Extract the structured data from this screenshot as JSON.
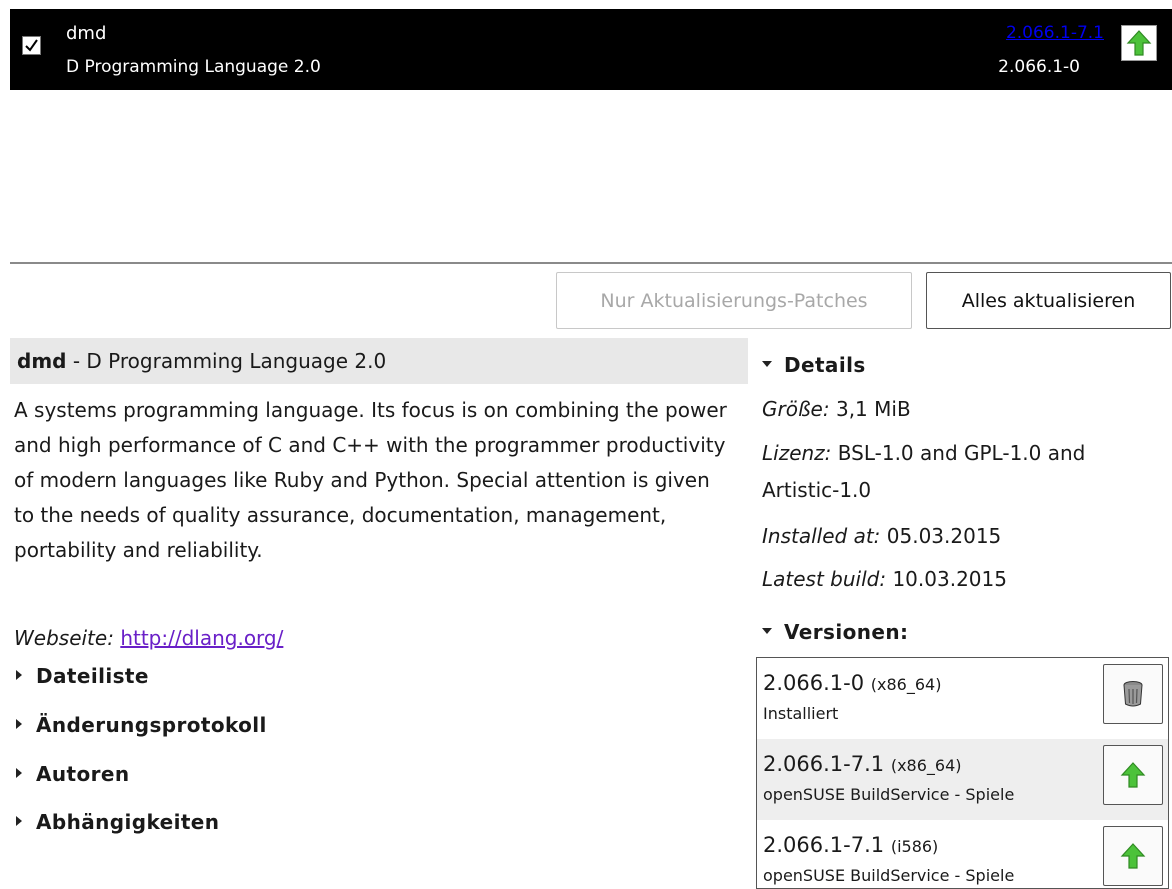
{
  "package": {
    "name": "dmd",
    "summary": "D Programming Language 2.0",
    "available_version": "2.066.1-7.1",
    "installed_version": "2.066.1-0",
    "checked": true
  },
  "buttons": {
    "patches_only": "Nur Aktualisierungs-Patches",
    "update_all": "Alles aktualisieren"
  },
  "description": {
    "name": "dmd",
    "separator": " - ",
    "summary": "D Programming Language 2.0",
    "body": "A systems programming language. Its focus is on combining the power and high performance of C and C++ with the programmer productivity of modern languages like Ruby and Python. Special attention is given to the needs of quality assurance, documentation, management, portability and reliability.",
    "homepage_label": "Webseite:",
    "homepage_url": "http://dlang.org/"
  },
  "expanders": [
    "Dateiliste",
    "Änderungsprotokoll",
    "Autoren",
    "Abhängigkeiten"
  ],
  "details": {
    "header": "Details",
    "size_label": "Größe:",
    "size_value": "3,1 MiB",
    "license_label": "Lizenz:",
    "license_value_line1": "BSL-1.0 and GPL-1.0 and",
    "license_value_line2": "Artistic-1.0",
    "installed_label": "Installed at:",
    "installed_value": "05.03.2015",
    "build_label": "Latest build:",
    "build_value": "10.03.2015"
  },
  "versions": {
    "header": "Versionen:",
    "items": [
      {
        "version": "2.066.1-0",
        "arch": "(x86_64)",
        "repo": "Installiert",
        "action_icon": "trash-icon"
      },
      {
        "version": "2.066.1-7.1",
        "arch": "(x86_64)",
        "repo": "openSUSE BuildService - Spiele",
        "action_icon": "upgrade-arrow-icon"
      },
      {
        "version": "2.066.1-7.1",
        "arch": "(i586)",
        "repo": "openSUSE BuildService - Spiele",
        "action_icon": "upgrade-arrow-icon"
      }
    ]
  },
  "colors": {
    "row_bg": "#000000",
    "link_blue": "#0000ee",
    "link_visited": "#6a20c8",
    "arrow_green": "#4cc23a",
    "title_bg": "#e8e8e8",
    "selected_row_bg": "#eeeeee"
  }
}
